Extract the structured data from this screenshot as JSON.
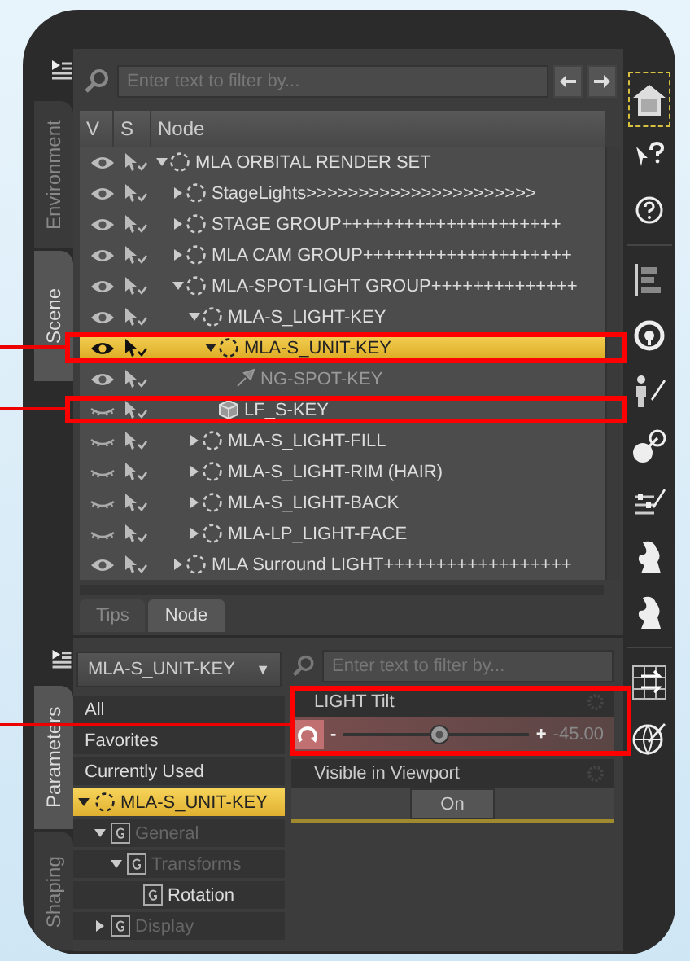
{
  "scene_tabs": [
    {
      "label": "Environment",
      "selected": false
    },
    {
      "label": "Scene",
      "selected": true
    }
  ],
  "scene_search": {
    "placeholder": "Enter text to filter by..."
  },
  "scene_columns": [
    "V",
    "S",
    "Node"
  ],
  "scene_tree": [
    {
      "label": "MLA ORBITAL RENDER SET",
      "kind": "group",
      "visible": true,
      "expanded": true,
      "selected": false,
      "children": [
        {
          "label": "StageLights>>>>>>>>>>>>>>>>>>>>>>",
          "kind": "group",
          "visible": true,
          "expanded": false,
          "selected": false
        },
        {
          "label": "STAGE GROUP+++++++++++++++++++++",
          "kind": "group",
          "visible": true,
          "expanded": false,
          "selected": false
        },
        {
          "label": "MLA CAM GROUP++++++++++++++++++++",
          "kind": "group",
          "visible": true,
          "expanded": false,
          "selected": false
        },
        {
          "label": "MLA-SPOT-LIGHT GROUP++++++++++++++",
          "kind": "group",
          "visible": true,
          "expanded": true,
          "selected": false,
          "children": [
            {
              "label": "MLA-S_LIGHT-KEY",
              "kind": "group",
              "visible": true,
              "expanded": true,
              "selected": false,
              "children": [
                {
                  "label": "MLA-S_UNIT-KEY",
                  "kind": "group",
                  "visible": true,
                  "expanded": true,
                  "selected": true,
                  "children": [
                    {
                      "label": "NG-SPOT-KEY",
                      "kind": "light",
                      "visible": true,
                      "selected": false
                    }
                  ]
                },
                {
                  "label": "LF_S-KEY",
                  "kind": "figure",
                  "visible": false,
                  "selected": false
                }
              ]
            },
            {
              "label": "MLA-S_LIGHT-FILL",
              "kind": "group",
              "visible": false,
              "expanded": false,
              "selected": false
            },
            {
              "label": "MLA-S_LIGHT-RIM (HAIR)",
              "kind": "group",
              "visible": false,
              "expanded": false,
              "selected": false
            },
            {
              "label": "MLA-S_LIGHT-BACK",
              "kind": "group",
              "visible": false,
              "expanded": false,
              "selected": false
            },
            {
              "label": "MLA-LP_LIGHT-FACE",
              "kind": "group",
              "visible": false,
              "expanded": false,
              "selected": false
            }
          ]
        },
        {
          "label": "MLA Surround LIGHT++++++++++++++++++",
          "kind": "group",
          "visible": true,
          "expanded": false,
          "selected": false
        }
      ]
    }
  ],
  "bottom_tabs": [
    {
      "label": "Tips",
      "selected": false
    },
    {
      "label": "Node",
      "selected": true
    }
  ],
  "param_tabs": [
    {
      "label": "Parameters",
      "selected": true
    },
    {
      "label": "Shaping",
      "selected": false
    }
  ],
  "node_dropdown": {
    "value": "MLA-S_UNIT-KEY",
    "arrow": "▼"
  },
  "filters": [
    {
      "label": "All",
      "selected": false
    },
    {
      "label": "Favorites",
      "selected": false
    },
    {
      "label": "Currently Used",
      "selected": false
    }
  ],
  "param_tree": [
    {
      "label": "MLA-S_UNIT-KEY",
      "kind": "node",
      "expanded": true,
      "selected": true,
      "disabled": false,
      "children": [
        {
          "label": "General",
          "kind": "group",
          "expanded": true,
          "selected": false,
          "disabled": true,
          "children": [
            {
              "label": "Transforms",
              "kind": "group",
              "expanded": true,
              "selected": false,
              "disabled": true,
              "children": [
                {
                  "label": "Rotation",
                  "kind": "group",
                  "selected": false,
                  "disabled": false
                }
              ]
            }
          ]
        },
        {
          "label": "Display",
          "kind": "group",
          "expanded": false,
          "selected": false,
          "disabled": true
        }
      ]
    }
  ],
  "param_search": {
    "placeholder": "Enter text to filter by..."
  },
  "properties": [
    {
      "kind": "slider",
      "label": "LIGHT Tilt",
      "minus": "-",
      "plus": "+",
      "level": 0.52,
      "value": "-45.00"
    },
    {
      "kind": "toggle",
      "label": "Visible in Viewport",
      "value": "On",
      "on": true
    }
  ]
}
